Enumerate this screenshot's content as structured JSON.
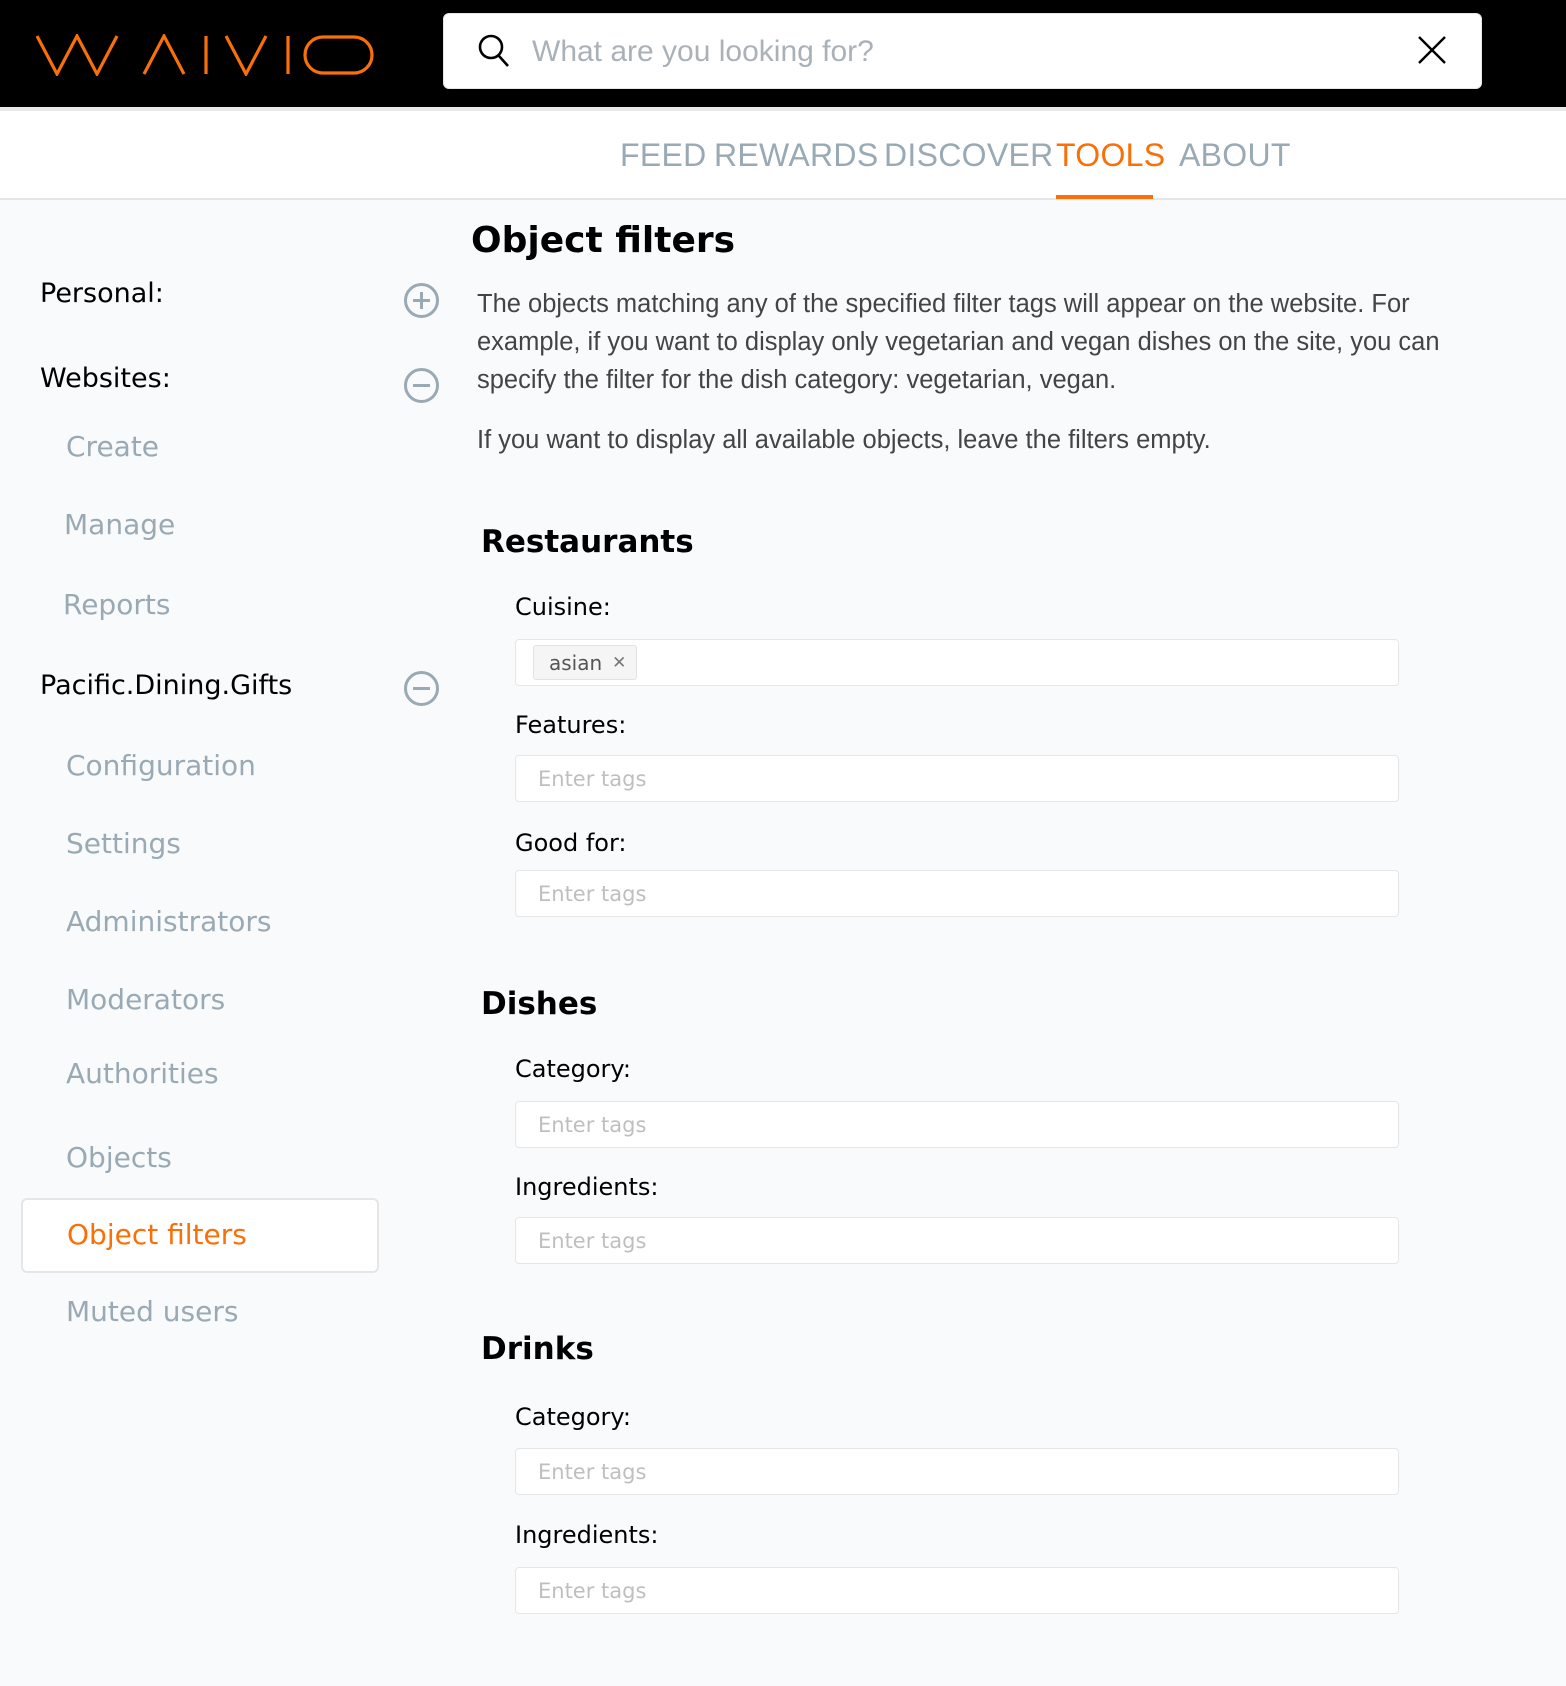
{
  "header": {
    "logo_text": "WAIVIO",
    "search": {
      "placeholder": "What are you looking for?",
      "value": ""
    }
  },
  "nav": {
    "items": [
      {
        "label": "FEED",
        "active": false
      },
      {
        "label": "REWARDS",
        "active": false
      },
      {
        "label": "DISCOVER",
        "active": false
      },
      {
        "label": "TOOLS",
        "active": true
      },
      {
        "label": "ABOUT",
        "active": false
      }
    ]
  },
  "sidebar": {
    "groups": [
      {
        "label": "Personal:",
        "toggle": "expand",
        "items": []
      },
      {
        "label": "Websites:",
        "toggle": "collapse",
        "items": [
          "Create",
          "Manage",
          "Reports"
        ]
      },
      {
        "label": "Pacific.Dining.Gifts",
        "toggle": "collapse",
        "items": [
          "Configuration",
          "Settings",
          "Administrators",
          "Moderators",
          "Authorities",
          "Objects",
          "Object filters",
          "Muted users"
        ]
      }
    ],
    "active_item": "Object filters"
  },
  "main": {
    "title": "Object filters",
    "description": "The objects matching any of the specified filter tags will appear on the website. For example, if you want to display only vegetarian and vegan dishes on the site, you can specify the filter for the dish category: vegetarian, vegan.",
    "note": "If you want to display all available objects, leave the filters empty.",
    "sections": [
      {
        "title": "Restaurants",
        "fields": [
          {
            "label": "Cuisine:",
            "tags": [
              "asian"
            ],
            "placeholder": ""
          },
          {
            "label": "Features:",
            "tags": [],
            "placeholder": "Enter tags"
          },
          {
            "label": "Good for:",
            "tags": [],
            "placeholder": "Enter tags"
          }
        ]
      },
      {
        "title": "Dishes",
        "fields": [
          {
            "label": "Category:",
            "tags": [],
            "placeholder": "Enter tags"
          },
          {
            "label": "Ingredients:",
            "tags": [],
            "placeholder": "Enter tags"
          }
        ]
      },
      {
        "title": "Drinks",
        "fields": [
          {
            "label": "Category:",
            "tags": [],
            "placeholder": "Enter tags"
          },
          {
            "label": "Ingredients:",
            "tags": [],
            "placeholder": "Enter tags"
          }
        ]
      }
    ]
  },
  "colors": {
    "accent": "#f87007",
    "muted": "#99aab5",
    "header_bg": "#000000",
    "page_bg": "#f9fafc"
  }
}
